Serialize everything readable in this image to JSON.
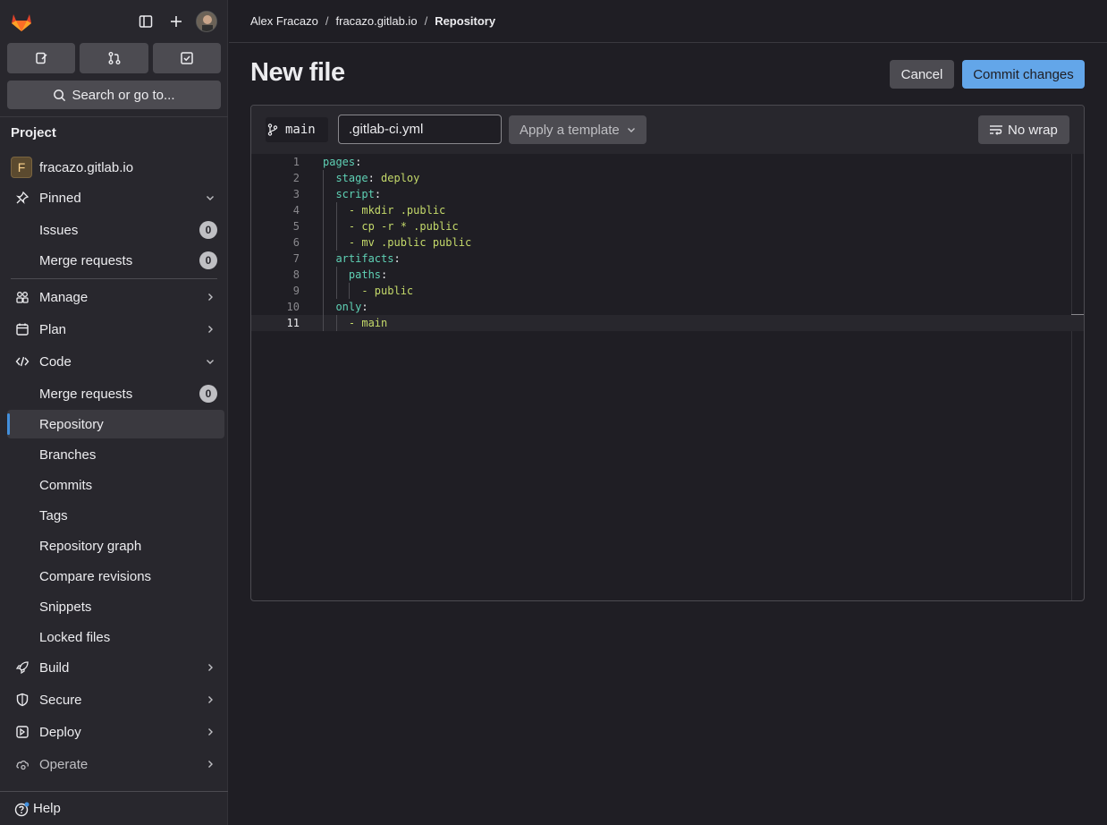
{
  "sidebar": {
    "search_label": "Search or go to...",
    "section_title": "Project",
    "project_name": "fracazo.gitlab.io",
    "project_initial": "F",
    "pinned": {
      "label": "Pinned",
      "items": [
        {
          "label": "Issues",
          "count": "0"
        },
        {
          "label": "Merge requests",
          "count": "0"
        }
      ]
    },
    "groups": {
      "manage": "Manage",
      "plan": "Plan",
      "code": "Code",
      "build": "Build",
      "secure": "Secure",
      "deploy": "Deploy",
      "operate": "Operate"
    },
    "code_items": {
      "merge_requests": {
        "label": "Merge requests",
        "count": "0"
      },
      "repository": "Repository",
      "branches": "Branches",
      "commits": "Commits",
      "tags": "Tags",
      "repository_graph": "Repository graph",
      "compare_revisions": "Compare revisions",
      "snippets": "Snippets",
      "locked_files": "Locked files"
    },
    "help": "Help"
  },
  "breadcrumb": {
    "user": "Alex Fracazo",
    "project": "fracazo.gitlab.io",
    "current": "Repository"
  },
  "page": {
    "title": "New file",
    "cancel": "Cancel",
    "commit": "Commit changes"
  },
  "editor": {
    "branch": "main",
    "filename": ".gitlab-ci.yml",
    "template_label": "Apply a template",
    "nowrap_label": "No wrap",
    "current_line": 11,
    "lines": [
      {
        "n": "1",
        "key": "pages",
        "punct": ":",
        "val": "",
        "indent": 0
      },
      {
        "n": "2",
        "key": "stage",
        "punct": ":",
        "val": " deploy",
        "indent": 2
      },
      {
        "n": "3",
        "key": "script",
        "punct": ":",
        "val": "",
        "indent": 2
      },
      {
        "n": "4",
        "key": "",
        "punct": "",
        "val": "- mkdir .public",
        "indent": 4
      },
      {
        "n": "5",
        "key": "",
        "punct": "",
        "val": "- cp -r * .public",
        "indent": 4
      },
      {
        "n": "6",
        "key": "",
        "punct": "",
        "val": "- mv .public public",
        "indent": 4
      },
      {
        "n": "7",
        "key": "artifacts",
        "punct": ":",
        "val": "",
        "indent": 2
      },
      {
        "n": "8",
        "key": "paths",
        "punct": ":",
        "val": "",
        "indent": 4
      },
      {
        "n": "9",
        "key": "",
        "punct": "",
        "val": "- public",
        "indent": 6
      },
      {
        "n": "10",
        "key": "only",
        "punct": ":",
        "val": "",
        "indent": 2
      },
      {
        "n": "11",
        "key": "",
        "punct": "",
        "val": "- main",
        "indent": 4
      }
    ]
  }
}
